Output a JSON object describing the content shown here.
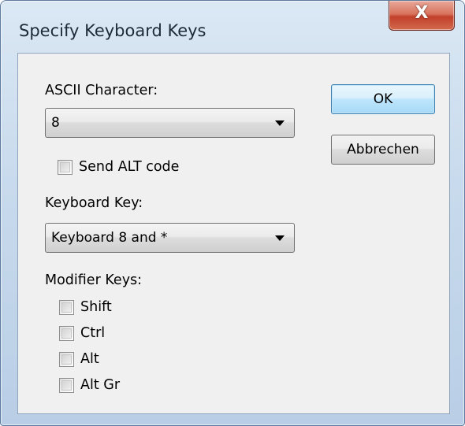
{
  "window": {
    "title": "Specify Keyboard Keys",
    "close_glyph": "X"
  },
  "ascii": {
    "label": "ASCII Character:",
    "value": "8",
    "send_alt_code_label": "Send ALT code",
    "send_alt_code_checked": false
  },
  "keyboard_key": {
    "label": "Keyboard Key:",
    "value": "Keyboard 8 and *"
  },
  "modifiers": {
    "label": "Modifier Keys:",
    "items": [
      {
        "label": "Shift",
        "checked": false
      },
      {
        "label": "Ctrl",
        "checked": false
      },
      {
        "label": "Alt",
        "checked": false
      },
      {
        "label": "Alt Gr",
        "checked": false
      }
    ]
  },
  "buttons": {
    "ok": "OK",
    "cancel": "Abbrechen"
  },
  "colors": {
    "accent_default_button": "#3c7fb1",
    "close_button": "#c2402a"
  }
}
